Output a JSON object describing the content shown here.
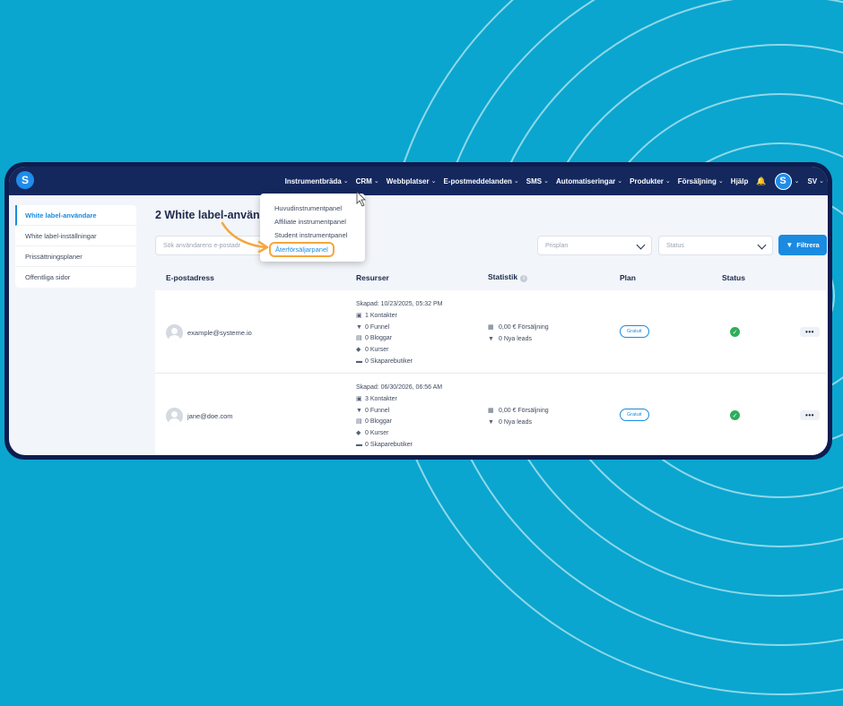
{
  "brand": {
    "logo_letter": "S",
    "accent": "#1a8be0",
    "nav_bg": "#14285e",
    "page_bg": "#0aa6cf"
  },
  "topnav": {
    "items": [
      {
        "label": "Instrumentbräda",
        "chevron": true
      },
      {
        "label": "CRM",
        "chevron": true
      },
      {
        "label": "Webbplatser",
        "chevron": true
      },
      {
        "label": "E-postmeddelanden",
        "chevron": true
      },
      {
        "label": "SMS",
        "chevron": true
      },
      {
        "label": "Automatiseringar",
        "chevron": true
      },
      {
        "label": "Produkter",
        "chevron": true
      },
      {
        "label": "Försäljning",
        "chevron": true
      },
      {
        "label": "Hjälp",
        "chevron": false
      }
    ],
    "bell_icon": "bell-icon",
    "avatar_letter": "S",
    "language": "SV"
  },
  "sidebar": {
    "items": [
      {
        "label": "White label-användare",
        "active": true
      },
      {
        "label": "White label-inställningar",
        "active": false
      },
      {
        "label": "Prissättningsplaner",
        "active": false
      },
      {
        "label": "Offentliga sidor",
        "active": false
      }
    ]
  },
  "main": {
    "title": "2 White label-använd",
    "search_placeholder": "Sök användarens e-postadr",
    "price_plan_placeholder": "Prisplan",
    "status_placeholder": "Status",
    "filter_label": "Filtrera"
  },
  "table": {
    "headers": {
      "email": "E-postadress",
      "resources": "Resurser",
      "stats": "Statistik",
      "plan": "Plan",
      "status": "Status"
    },
    "rows": [
      {
        "email": "example@systeme.io",
        "created": "Skapad: 10/23/2025, 05:32 PM",
        "contacts": "1 Kontakter",
        "funnels": "0 Funnel",
        "blogs": "0 Bloggar",
        "courses": "0 Kurser",
        "stores": "0 Skaparebutiker",
        "sales": "0,00 € Försäljning",
        "leads": "0 Nya leads",
        "plan": "Gratuit",
        "more": "•••"
      },
      {
        "email": "jane@doe.com",
        "created": "Skapad: 06/30/2026, 06:56 AM",
        "contacts": "3 Kontakter",
        "funnels": "0 Funnel",
        "blogs": "0 Bloggar",
        "courses": "0 Kurser",
        "stores": "0 Skaparebutiker",
        "sales": "0,00 € Försäljning",
        "leads": "0 Nya leads",
        "plan": "Gratuit",
        "more": "•••"
      }
    ]
  },
  "dropdown": {
    "items": [
      {
        "label": "Huvudinstrumentpanel",
        "highlighted": false
      },
      {
        "label": "Affiliate instrumentpanel",
        "highlighted": false
      },
      {
        "label": "Student instrumentpanel",
        "highlighted": false
      },
      {
        "label": "Återförsäljarpanel",
        "highlighted": true
      }
    ],
    "highlight_color": "#f5a63d"
  }
}
